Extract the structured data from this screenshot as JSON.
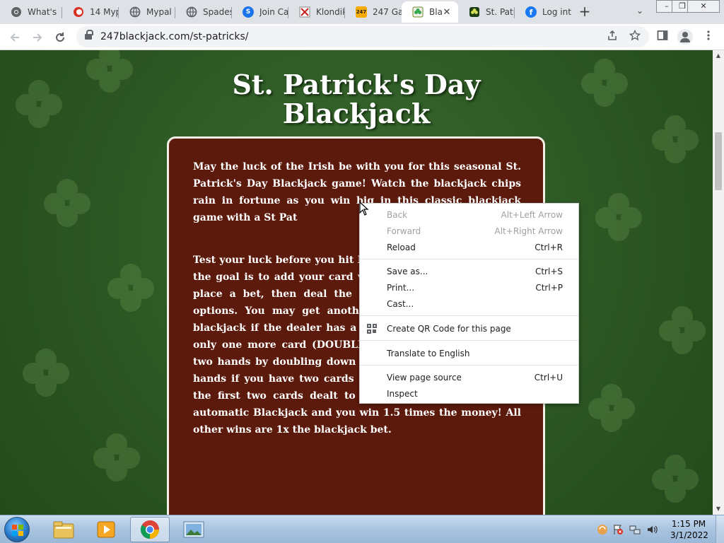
{
  "browser": {
    "tabs": [
      {
        "title": "What's",
        "icon": "chrome-icon",
        "color": "#5f6368"
      },
      {
        "title": "14 Myp",
        "icon": "mypoints-icon",
        "color": "#d93025"
      },
      {
        "title": "Mypal",
        "icon": "globe-icon",
        "color": "#5f6368"
      },
      {
        "title": "Spades",
        "icon": "globe-icon",
        "color": "#5f6368"
      },
      {
        "title": "Join Ca",
        "icon": "swagbucks-icon",
        "color": "#1a73e8"
      },
      {
        "title": "Klondik",
        "icon": "klondike-icon",
        "color": "#c5221f"
      },
      {
        "title": "247 Ga",
        "icon": "247-icon",
        "color": "#f9ab00"
      },
      {
        "title": "Bla",
        "icon": "blackjack-clover-icon",
        "color": "#34a853"
      },
      {
        "title": "St. Patr",
        "icon": "clover-icon",
        "color": "#1e8e3e"
      },
      {
        "title": "Log int",
        "icon": "facebook-icon",
        "color": "#1877f2"
      }
    ],
    "new_tab_symbol": "+",
    "tab_search_symbol": "⌄",
    "close_symbol": "✕",
    "url": "247blackjack.com/st-patricks/",
    "window_controls": {
      "minimize": "–",
      "restore": "❐",
      "close": "✕"
    }
  },
  "page": {
    "title": "St. Patrick's Day Blackjack",
    "paragraphs": [
      "May the luck of the Irish be with you for this seasonal St. Patrick's Day Blackjack game! Watch the blackjack chips rain in fortune as you win big in this classic blackjack game with a St Pat",
      "Test your luck before you hit Day Blackjack. Blackjack is a the goal is to add your card while beating the dealer. Sel place a bet, then deal the cards and money pile, you' options. You may get another you have (STAY), insure blackjack if the dealer has a double your bet and receive only one more card (DOUBLE), and split your hand into two hands by doubling down on your bet and playing two hands if you have two cards of the same kind (SPLIT). If the first two cards dealt to you equal 21, you have an automatic Blackjack and you win 1.5 times the money! All other wins are 1x the blackjack bet."
    ]
  },
  "context_menu": {
    "items": [
      {
        "label": "Back",
        "shortcut": "Alt+Left Arrow",
        "disabled": true
      },
      {
        "label": "Forward",
        "shortcut": "Alt+Right Arrow",
        "disabled": true
      },
      {
        "label": "Reload",
        "shortcut": "Ctrl+R",
        "disabled": false
      },
      {
        "label": "Save as...",
        "shortcut": "Ctrl+S",
        "disabled": false
      },
      {
        "label": "Print...",
        "shortcut": "Ctrl+P",
        "disabled": false
      },
      {
        "label": "Cast...",
        "shortcut": "",
        "disabled": false
      },
      {
        "label": "Create QR Code for this page",
        "shortcut": "",
        "disabled": false
      },
      {
        "label": "Translate to English",
        "shortcut": "",
        "disabled": false
      },
      {
        "label": "View page source",
        "shortcut": "Ctrl+U",
        "disabled": false
      },
      {
        "label": "Inspect",
        "shortcut": "",
        "disabled": false
      }
    ]
  },
  "taskbar": {
    "clock_time": "1:15 PM",
    "clock_date": "3/1/2022",
    "pinned": [
      "explorer-icon",
      "media-player-icon",
      "chrome-icon",
      "image-viewer-icon"
    ]
  },
  "colors": {
    "page_background": "#2b5522",
    "info_box": "#5b1a0b",
    "info_border": "#f3efe6"
  }
}
